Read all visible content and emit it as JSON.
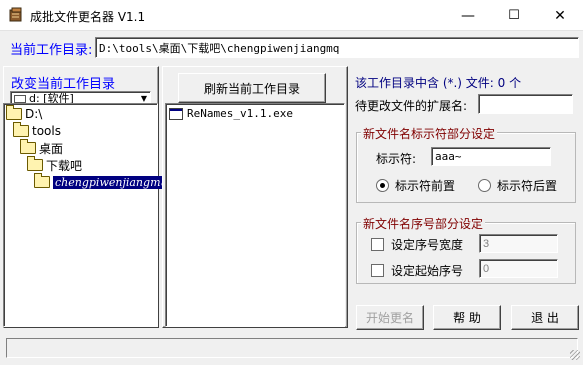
{
  "window": {
    "title": "成批文件更名器 V1.1",
    "minimize": "—",
    "maximize": "☐",
    "close": "✕"
  },
  "current_dir": {
    "label": "当前工作目录:",
    "value": "D:\\tools\\桌面\\下载吧\\chengpiwenjiangmq"
  },
  "left": {
    "change_dir_label": "改变当前工作目录",
    "drive_value": "d: [软件]",
    "tree": [
      {
        "label": "D:\\",
        "indent": 0,
        "selected": false
      },
      {
        "label": "tools",
        "indent": 1,
        "selected": false
      },
      {
        "label": "桌面",
        "indent": 2,
        "selected": false
      },
      {
        "label": "下载吧",
        "indent": 3,
        "selected": false
      },
      {
        "label": "chengpiwenjiangmq",
        "indent": 4,
        "selected": true
      }
    ]
  },
  "middle": {
    "refresh_label": "刷新当前工作目录",
    "files": [
      "ReNames_v1.1.exe"
    ]
  },
  "right": {
    "file_count_label": "该工作目录中含 (*.) 文件: 0 个",
    "ext_label": "待更改文件的扩展名:",
    "ext_value": "",
    "marker_group": {
      "title": "新文件名标示符部分设定",
      "marker_label": "标示符:",
      "marker_value": "aaa~",
      "radio_front": "标示符前置",
      "radio_back": "标示符后置",
      "selected": "front"
    },
    "seq_group": {
      "title": "新文件名序号部分设定",
      "width_label": "设定序号宽度",
      "width_value": "3",
      "start_label": "设定起始序号",
      "start_value": "0"
    },
    "buttons": {
      "start": "开始更名",
      "help": "帮 助",
      "exit": "退 出"
    }
  },
  "statusbar": {
    "text": ""
  }
}
